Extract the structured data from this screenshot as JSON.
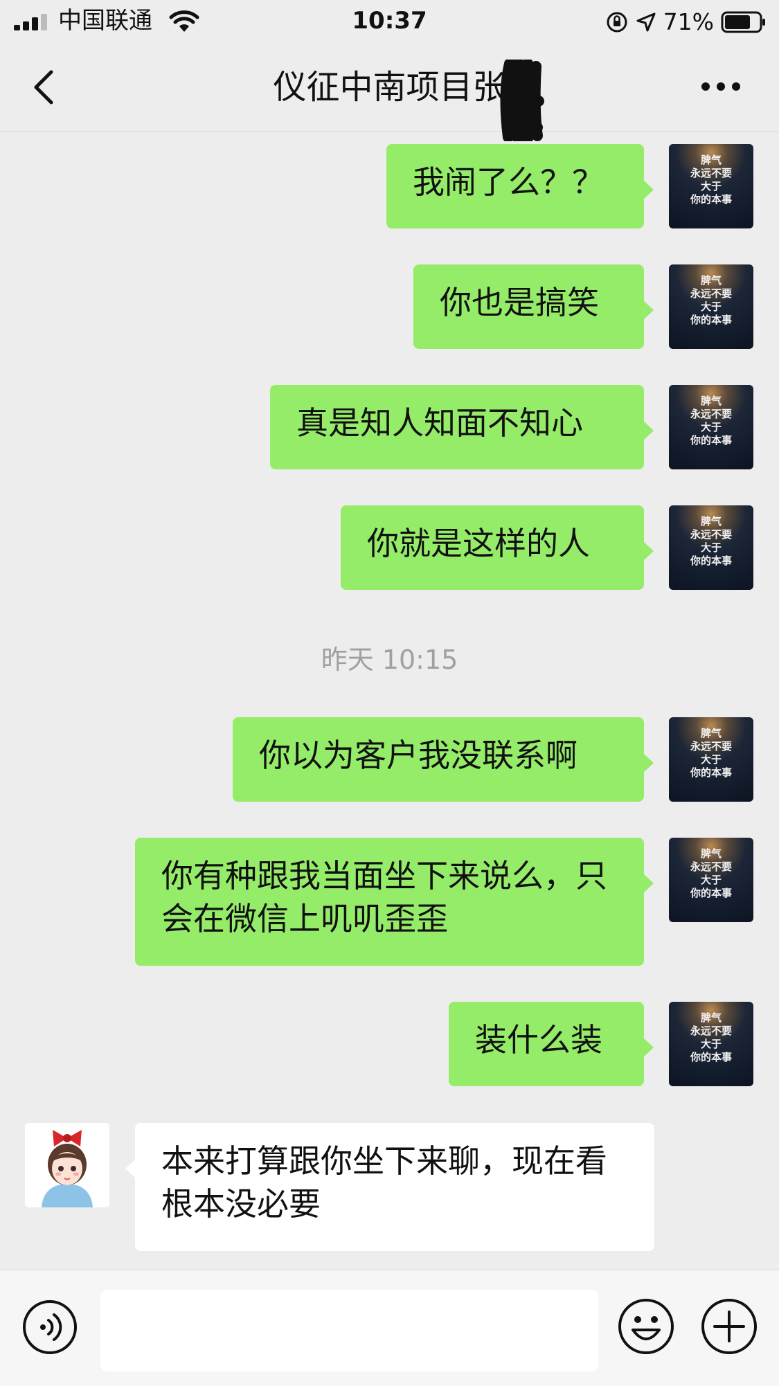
{
  "status_bar": {
    "carrier": "中国联通",
    "time": "10:37",
    "battery_percent": "71%"
  },
  "nav": {
    "title": "仪征中南项目张"
  },
  "avatar_text": {
    "line1": "脾气",
    "line2": "永远不要",
    "line3": "大于",
    "line4": "你的本事"
  },
  "messages": [
    {
      "sender": "me",
      "text": "我闹了么？？"
    },
    {
      "sender": "me",
      "text": "你也是搞笑"
    },
    {
      "sender": "me",
      "text": "真是知人知面不知心"
    },
    {
      "sender": "me",
      "text": "你就是这样的人"
    },
    {
      "sender": "me",
      "text": "你以为客户我没联系啊"
    },
    {
      "sender": "me",
      "text": "你有种跟我当面坐下来说么，只会在微信上叽叽歪歪"
    },
    {
      "sender": "me",
      "text": "装什么装"
    },
    {
      "sender": "contact",
      "text": "本来打算跟你坐下来聊，现在看根本没必要"
    }
  ],
  "timestamp": "昨天 10:15",
  "input": {
    "value": ""
  },
  "colors": {
    "my_bubble": "#95ec69",
    "their_bubble": "#ffffff",
    "background": "#ededed"
  },
  "icons": [
    "signal-icon",
    "wifi-icon",
    "orientation-lock-icon",
    "location-arrow-icon",
    "battery-icon",
    "back-chevron-icon",
    "more-dots-icon",
    "voice-icon",
    "emoji-icon",
    "plus-icon"
  ]
}
